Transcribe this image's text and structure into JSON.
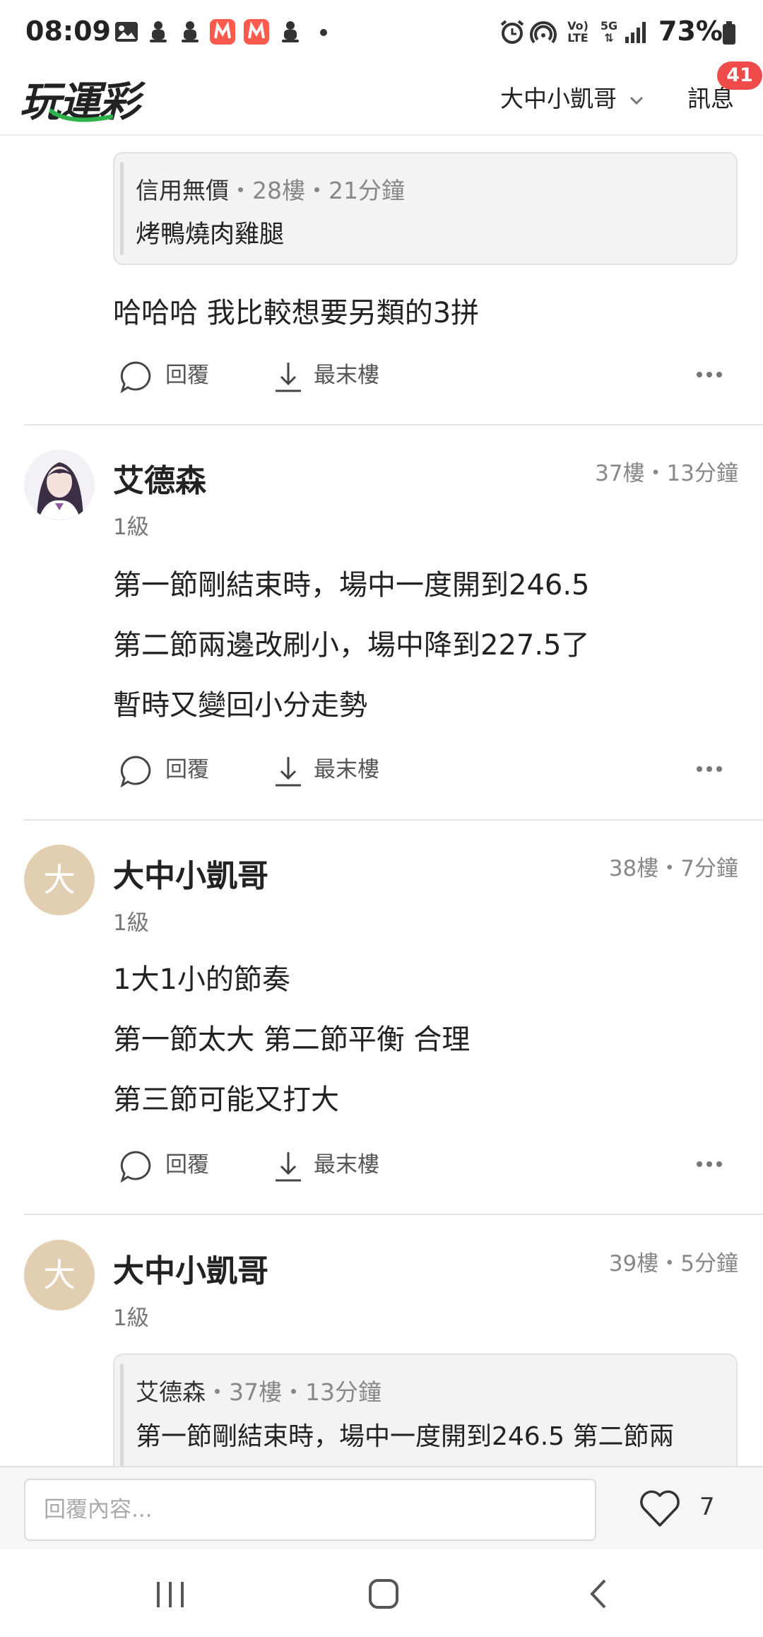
{
  "status_bar": {
    "time": "08:09",
    "battery_percent": "73%",
    "network_5g": "5G",
    "volte_top": "Vo)",
    "volte_bottom": "LTE",
    "notification_icons": [
      "image-icon",
      "android-icon",
      "android-icon",
      "app-m-icon",
      "app-m-icon",
      "android-icon",
      "dot-icon"
    ],
    "system_icons": [
      "alarm-icon",
      "hotspot-icon",
      "volte-icon",
      "5g-icon",
      "signal-icon",
      "battery-icon"
    ]
  },
  "header": {
    "logo_text": "玩運彩",
    "user_name": "大中小凱哥",
    "messages_label": "訊息",
    "messages_badge": "41"
  },
  "posts": [
    {
      "quote": {
        "author": "信用無價",
        "meta": "・28樓・21分鐘",
        "text": "烤鴨燒肉雞腿"
      },
      "lines": [
        "哈哈哈 我比較想要另類的3拼"
      ],
      "actions": {
        "reply": "回覆",
        "last_floor": "最末樓"
      }
    },
    {
      "author": "艾德森",
      "level": "1級",
      "floor_meta": "37樓・13分鐘",
      "lines": [
        "第一節剛結束時，場中一度開到246.5",
        "第二節兩邊改刷小，場中降到227.5了",
        "暫時又變回小分走勢"
      ],
      "actions": {
        "reply": "回覆",
        "last_floor": "最末樓"
      }
    },
    {
      "author": "大中小凱哥",
      "avatar_letter": "大",
      "level": "1級",
      "floor_meta": "38樓・7分鐘",
      "lines": [
        "1大1小的節奏",
        "第一節太大 第二節平衡 合理",
        "第三節可能又打大"
      ],
      "actions": {
        "reply": "回覆",
        "last_floor": "最末樓"
      }
    },
    {
      "author": "大中小凱哥",
      "avatar_letter": "大",
      "level": "1級",
      "floor_meta": "39樓・5分鐘",
      "quote": {
        "author": "艾德森",
        "meta": "・37樓・13分鐘",
        "text": "第一節剛結束時，場中一度開到246.5 第二節兩"
      }
    }
  ],
  "reply_bar": {
    "placeholder": "回覆內容...",
    "like_count": "7"
  },
  "colors": {
    "badge": "#ef4b4b",
    "logo_green": "#2db34a",
    "avatar_beige": "#e2cfb2"
  }
}
